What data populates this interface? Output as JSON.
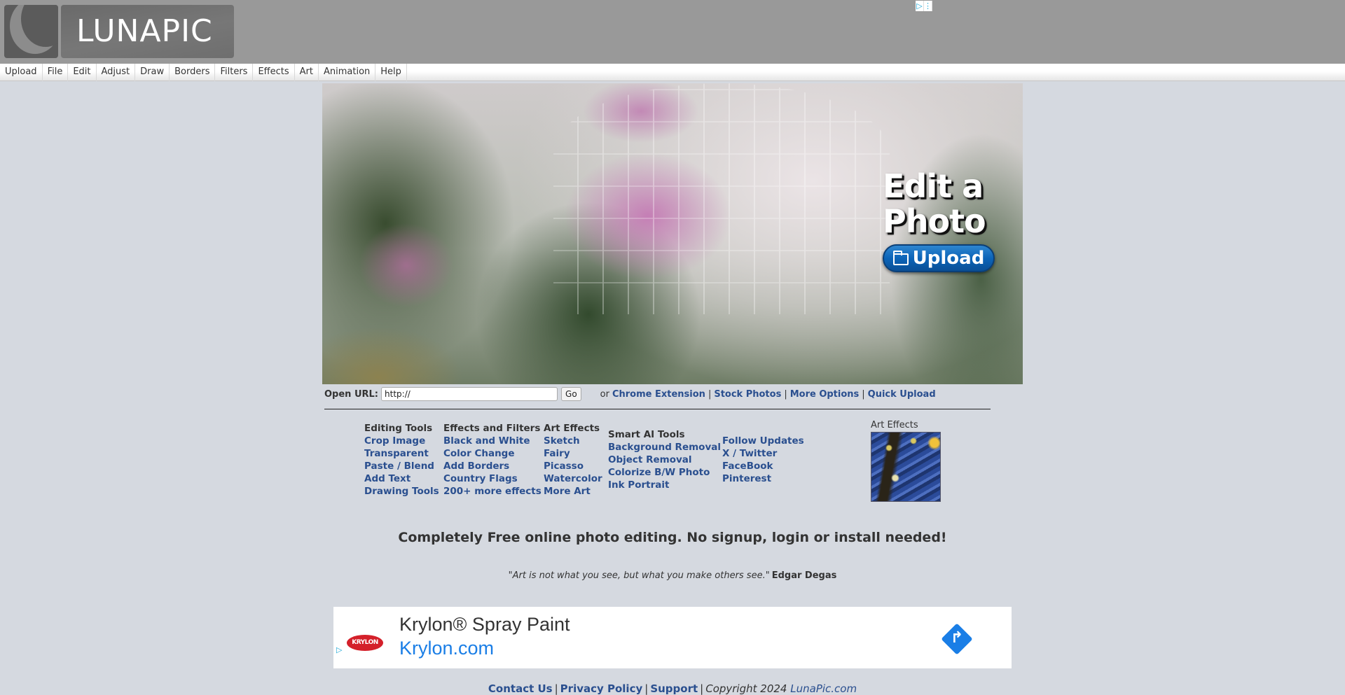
{
  "header": {
    "logo_text": "LUNAPIC",
    "ad_choices": {
      "play_glyph": "▷",
      "menu_glyph": "⋮"
    }
  },
  "menu": [
    "Upload",
    "File",
    "Edit",
    "Adjust",
    "Draw",
    "Borders",
    "Filters",
    "Effects",
    "Art",
    "Animation",
    "Help"
  ],
  "hero": {
    "title_line1": "Edit a",
    "title_line2": "Photo",
    "upload_label": "Upload"
  },
  "url_row": {
    "label": "Open URL:",
    "input_value": "http://",
    "go_label": "Go",
    "or_text": "or",
    "links": [
      "Chrome Extension",
      "Stock Photos",
      "More Options",
      "Quick Upload"
    ],
    "separator": "|"
  },
  "columns": {
    "editing": {
      "heading": "Editing Tools",
      "links": [
        "Crop Image",
        "Transparent",
        "Paste / Blend",
        "Add Text",
        "Drawing Tools"
      ]
    },
    "effects": {
      "heading": "Effects and Filters",
      "links": [
        "Black and White",
        "Color Change",
        "Add Borders",
        "Country Flags",
        "200+ more effects"
      ]
    },
    "art": {
      "heading": "Art Effects",
      "links": [
        "Sketch",
        "Fairy",
        "Picasso",
        "Watercolor",
        "More Art"
      ]
    },
    "ai": {
      "heading": "Smart AI Tools",
      "links": [
        "Background Removal",
        "Object Removal",
        "Colorize B/W Photo",
        "Ink Portrait"
      ]
    },
    "follow": {
      "links": [
        "Follow Updates",
        "X / Twitter",
        "FaceBook",
        "Pinterest"
      ]
    },
    "art_thumb_label": "Art Effects"
  },
  "tagline": "Completely Free online photo editing. No signup, login or install needed!",
  "quote": {
    "text": "\"Art is not what you see, but what you make others see.\"",
    "author": "Edgar Degas"
  },
  "ad": {
    "logo_text": "KRYLON",
    "title": "Krylon® Spray Paint",
    "url": "Krylon.com",
    "mark_glyph": "▷",
    "arrow_glyph": "↱"
  },
  "footer": {
    "links": [
      "Contact Us",
      "Privacy Policy",
      "Support"
    ],
    "separator": "|",
    "copyright": "Copyright 2024",
    "site": "LunaPic.com"
  },
  "colors": {
    "link": "#2a4f8f",
    "page_bg": "#d5d9e0",
    "header_bg": "#999999",
    "upload_button": "#0b64b8",
    "ad_link": "#1a7ee6"
  }
}
